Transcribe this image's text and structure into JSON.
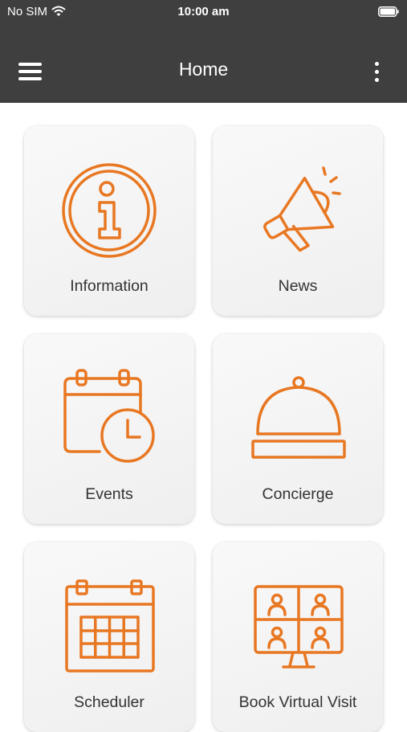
{
  "status_bar": {
    "carrier": "No SIM",
    "time": "10:00 am",
    "wifi_icon": "wifi-icon",
    "battery_icon": "battery-icon"
  },
  "nav": {
    "title": "Home",
    "menu_icon": "hamburger-menu-icon",
    "more_icon": "more-vertical-icon",
    "color": "#3f3f3f"
  },
  "accent_color": "#e87722",
  "tiles": [
    {
      "label": "Information",
      "icon": "info-icon"
    },
    {
      "label": "News",
      "icon": "megaphone-icon"
    },
    {
      "label": "Events",
      "icon": "calendar-clock-icon"
    },
    {
      "label": "Concierge",
      "icon": "service-bell-icon"
    },
    {
      "label": "Scheduler",
      "icon": "calendar-grid-icon"
    },
    {
      "label": "Book Virtual Visit",
      "icon": "video-call-icon"
    }
  ]
}
